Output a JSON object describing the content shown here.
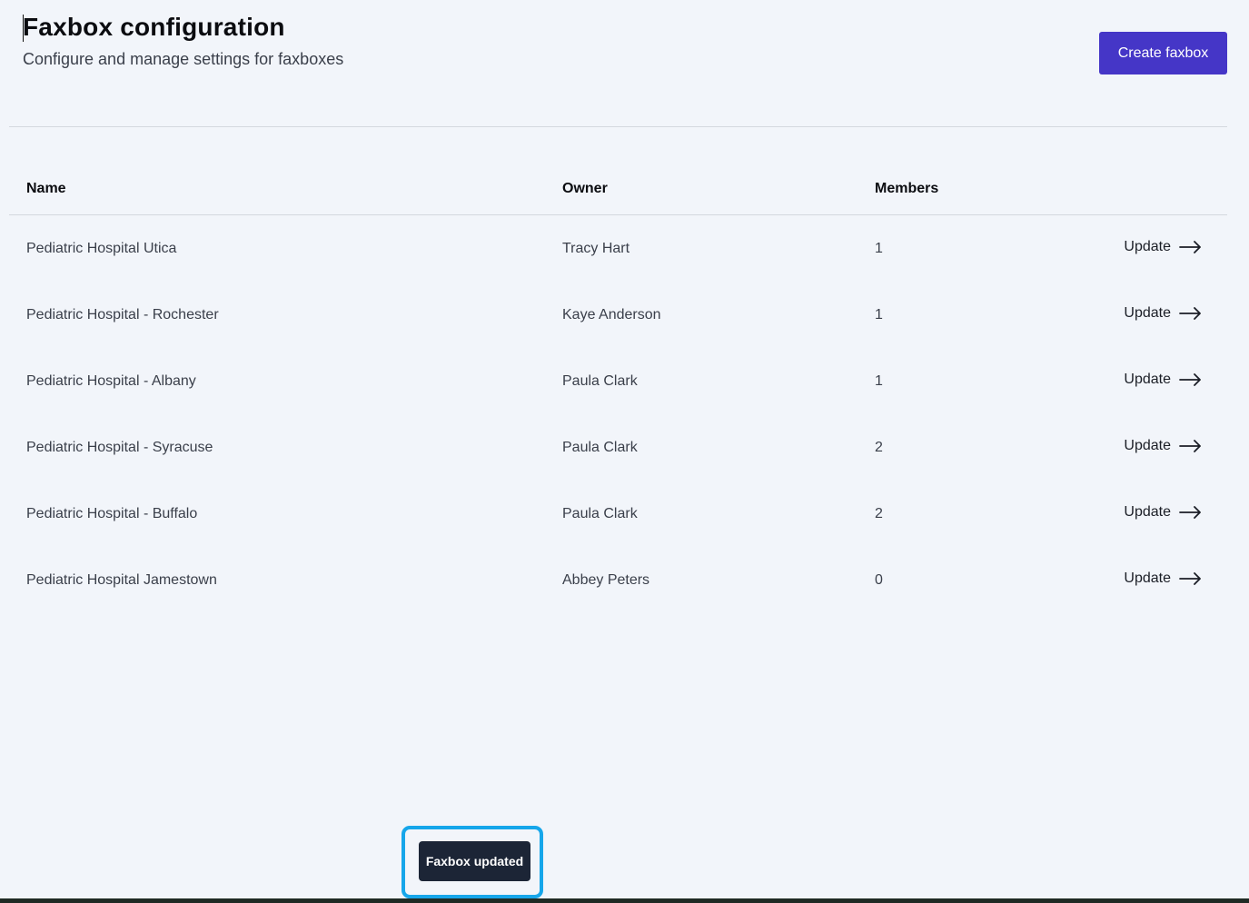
{
  "header": {
    "title": "Faxbox configuration",
    "subtitle": "Configure and manage settings for faxboxes",
    "create_label": "Create faxbox",
    "create_color": "#4536c7"
  },
  "table": {
    "columns": {
      "name": "Name",
      "owner": "Owner",
      "members": "Members"
    },
    "rows": [
      {
        "name": "Pediatric Hospital Utica",
        "owner": "Tracy Hart",
        "members": "1",
        "action": "Update"
      },
      {
        "name": "Pediatric Hospital - Rochester",
        "owner": "Kaye Anderson",
        "members": "1",
        "action": "Update"
      },
      {
        "name": "Pediatric Hospital - Albany",
        "owner": "Paula Clark",
        "members": "1",
        "action": "Update"
      },
      {
        "name": "Pediatric Hospital - Syracuse",
        "owner": "Paula Clark",
        "members": "2",
        "action": "Update"
      },
      {
        "name": "Pediatric Hospital - Buffalo",
        "owner": "Paula Clark",
        "members": "2",
        "action": "Update"
      },
      {
        "name": "Pediatric Hospital Jamestown",
        "owner": "Abbey Peters",
        "members": "0",
        "action": "Update"
      }
    ]
  },
  "toast": {
    "message": "Faxbox updated",
    "highlight_color": "#16a6ea"
  },
  "icons": {
    "row_action": "arrow-right-icon"
  }
}
